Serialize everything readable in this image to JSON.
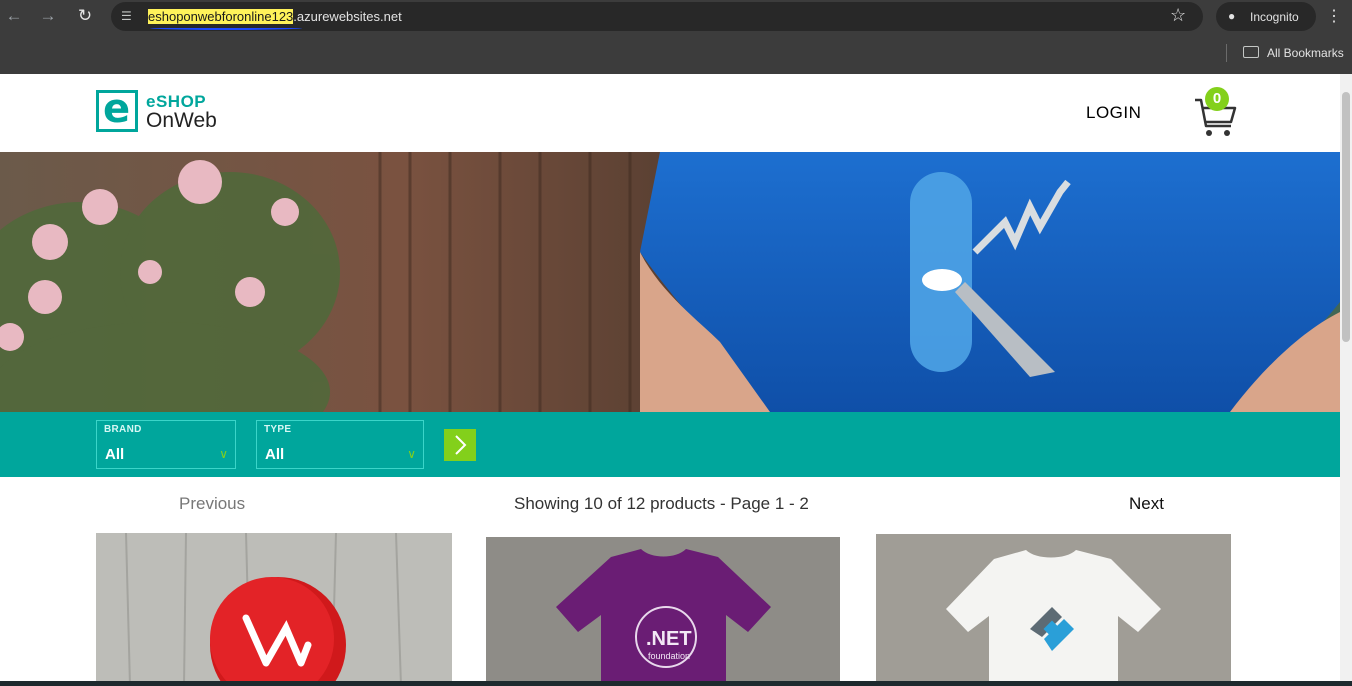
{
  "browser": {
    "url_highlighted": "eshoponwebforonline123",
    "url_rest": ".azurewebsites.net",
    "incognito_label": "Incognito",
    "bookmarks_label": "All Bookmarks"
  },
  "header": {
    "logo_line1": "eSHOP",
    "logo_line2": "OnWeb",
    "logo_mark": "e",
    "login_label": "LOGIN",
    "cart_count": "0"
  },
  "filters": {
    "brand": {
      "label": "BRAND",
      "value": "All"
    },
    "type": {
      "label": "TYPE",
      "value": "All"
    }
  },
  "pager": {
    "previous": "Previous",
    "status": "Showing 10 of 12 products - Page 1 - 2",
    "next": "Next"
  },
  "products": [
    {
      "image": "red-pin-image"
    },
    {
      "image": "purple-net-tshirt-image",
      "print": ".NET",
      "print_sub": "foundation"
    },
    {
      "image": "white-tshirt-image"
    }
  ],
  "colors": {
    "accent": "#00a69c",
    "green": "#83d01b",
    "chrome": "#3c3c3c"
  }
}
